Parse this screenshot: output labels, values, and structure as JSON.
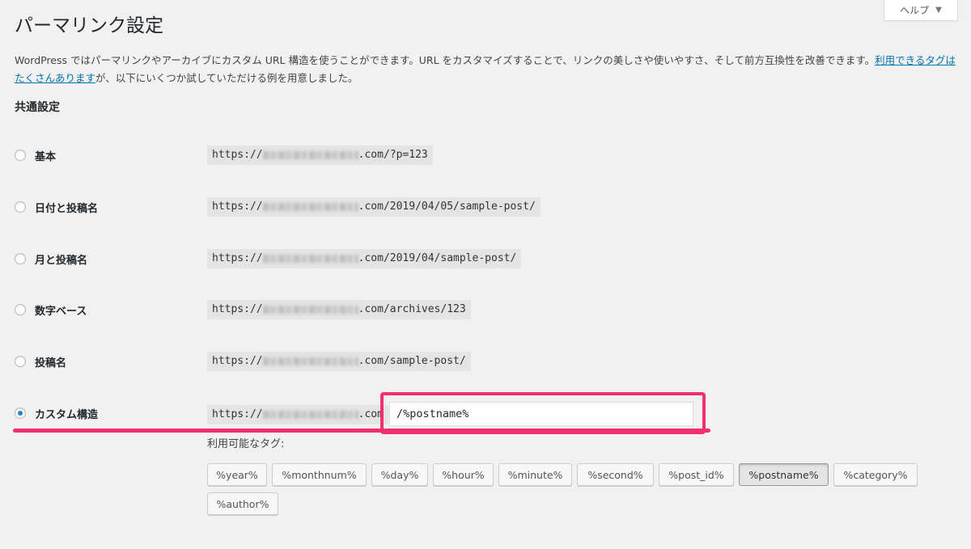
{
  "help_button": "ヘルプ",
  "page_title": "パーマリンク設定",
  "description": {
    "text_before": "WordPress ではパーマリンクやアーカイブにカスタム URL 構造を使うことができます。URL をカスタマイズすることで、リンクの美しさや使いやすさ、そして前方互換性を改善できます。",
    "link": "利用できるタグはたくさんあります",
    "text_after": "が、以下にいくつか試していただける例を用意しました。"
  },
  "section_heading": "共通設定",
  "url_prefix": "https://",
  "url_domain_suffix": ".com",
  "options": [
    {
      "label": "基本",
      "path": "/?p=123",
      "selected": false
    },
    {
      "label": "日付と投稿名",
      "path": "/2019/04/05/sample-post/",
      "selected": false
    },
    {
      "label": "月と投稿名",
      "path": "/2019/04/sample-post/",
      "selected": false
    },
    {
      "label": "数字ベース",
      "path": "/archives/123",
      "selected": false
    },
    {
      "label": "投稿名",
      "path": "/sample-post/",
      "selected": false
    },
    {
      "label": "カスタム構造",
      "path": "",
      "selected": true
    }
  ],
  "custom_structure_value": "/%postname%",
  "available_tags_label": "利用可能なタグ:",
  "tags": [
    "%year%",
    "%monthnum%",
    "%day%",
    "%hour%",
    "%minute%",
    "%second%",
    "%post_id%",
    "%postname%",
    "%category%",
    "%author%"
  ],
  "active_tag": "%postname%",
  "colors": {
    "highlight": "#f0316c",
    "link": "#0073aa",
    "radio_selected": "#1e8cbe"
  }
}
